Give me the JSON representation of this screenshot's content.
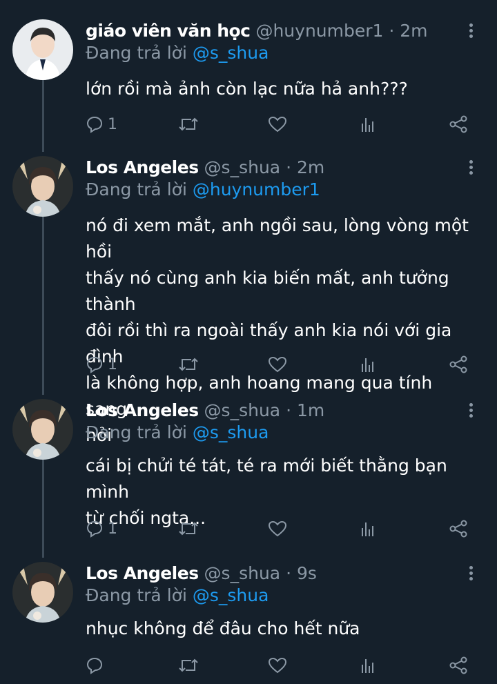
{
  "tweets": [
    {
      "name": "giáo viên văn học",
      "handle": "@huynumber1",
      "dot": "·",
      "time": "2m",
      "reply_prefix": "Đang trả lời",
      "reply_to": "@s_shua",
      "text": "lớn rồi mà ảnh còn lạc nữa hả anh???",
      "reply_count": "1"
    },
    {
      "name": "Los Angeles",
      "handle": "@s_shua",
      "dot": "·",
      "time": "2m",
      "reply_prefix": "Đang trả lời",
      "reply_to": "@huynumber1",
      "text": "nó đi xem mắt, anh ngồi sau, lòng vòng một hồi\nthấy nó cùng anh kia biến mất, anh tưởng thành\nđôi rồi thì ra ngoài thấy anh kia nói với gia đình\nlà không hợp, anh hoang mang qua tính sang\nhỏi",
      "reply_count": "1"
    },
    {
      "name": "Los Angeles",
      "handle": "@s_shua",
      "dot": "·",
      "time": "1m",
      "reply_prefix": "Đang trả lời",
      "reply_to": "@s_shua",
      "text": "cái bị chửi té tát, té ra mới biết thằng bạn mình\ntừ chối ngta...",
      "reply_count": "1"
    },
    {
      "name": "Los Angeles",
      "handle": "@s_shua",
      "dot": "·",
      "time": "9s",
      "reply_prefix": "Đang trả lời",
      "reply_to": "@s_shua",
      "text": "nhục không để đâu cho hết nữa",
      "reply_count": ""
    }
  ],
  "colors": {
    "background": "#15202b",
    "secondary_text": "#8b98a5",
    "mention": "#1d9bf0",
    "thread_line": "#3d4b58"
  },
  "icons": [
    "reply-icon",
    "retweet-icon",
    "like-icon",
    "analytics-icon",
    "share-icon",
    "more-icon"
  ]
}
